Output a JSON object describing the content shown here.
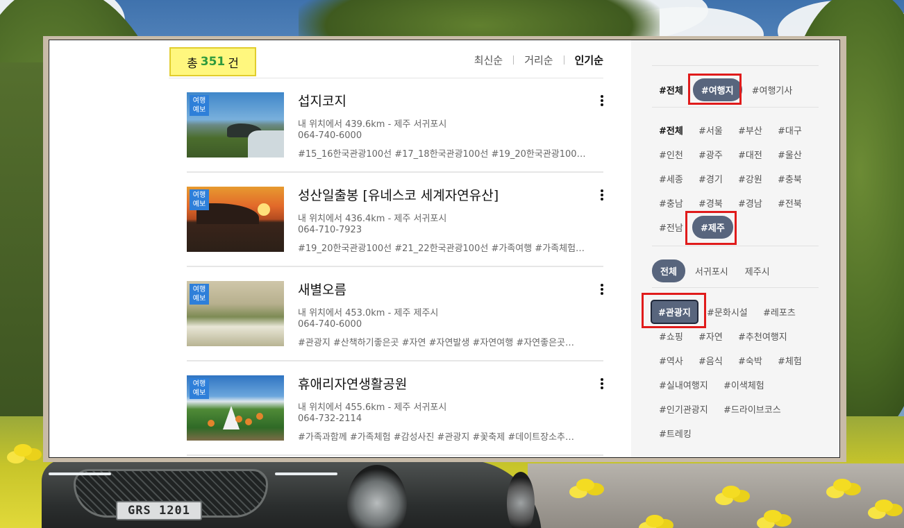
{
  "header": {
    "count_prefix": "총",
    "count_value": "351",
    "count_suffix": "건",
    "sort_options": [
      "최신순",
      "거리순",
      "인기순"
    ],
    "sort_active": "인기순"
  },
  "badge_text": "여행\n예보",
  "items": [
    {
      "title": "섭지코지",
      "location": "내 위치에서 439.6km - 제주 서귀포시",
      "phone": "064-740-6000",
      "tags": "#15_16한국관광100선 #17_18한국관광100선 #19_20한국관광100…"
    },
    {
      "title": "성산일출봉 [유네스코 세계자연유산]",
      "location": "내 위치에서 436.4km - 제주 서귀포시",
      "phone": "064-710-7923",
      "tags": "#19_20한국관광100선 #21_22한국관광100선 #가족여행 #가족체험…"
    },
    {
      "title": "새별오름",
      "location": "내 위치에서 453.0km - 제주 제주시",
      "phone": "064-740-6000",
      "tags": "#관광지 #산책하기좋은곳 #자연 #자연발생 #자연여행 #자연좋은곳…"
    },
    {
      "title": "휴애리자연생활공원",
      "location": "내 위치에서 455.6km - 제주 서귀포시",
      "phone": "064-732-2114",
      "tags": "#가족과함께 #가족체험 #감성사진 #관광지 #꽃축제 #데이트장소추…"
    }
  ],
  "sidebar": {
    "type_tabs": [
      "#전체",
      "#여행지",
      "#여행기사"
    ],
    "type_active": "#여행지",
    "regions": [
      "#전체",
      "#서울",
      "#부산",
      "#대구",
      "#인천",
      "#광주",
      "#대전",
      "#울산",
      "#세종",
      "#경기",
      "#강원",
      "#충북",
      "#충남",
      "#경북",
      "#경남",
      "#전북",
      "#전남",
      "#제주"
    ],
    "region_active": "#제주",
    "subregions": [
      "전체",
      "서귀포시",
      "제주시"
    ],
    "subregion_active": "전체",
    "categories": [
      "#관광지",
      "#문화시설",
      "#레포츠",
      "#쇼핑",
      "#자연",
      "#추천여행지",
      "#역사",
      "#음식",
      "#숙박",
      "#체험",
      "#실내여행지",
      "#이색체험",
      "#인기관광지",
      "#드라이브코스",
      "#트레킹"
    ],
    "category_active": "#관광지"
  },
  "background": {
    "plate_text": "GRS 1201"
  },
  "colors": {
    "count_highlight": "#fff77e",
    "count_number": "#2f9a3d",
    "pill": "#58657d",
    "highlight_box": "#e01b1b",
    "badge": "#2e7fd9"
  }
}
